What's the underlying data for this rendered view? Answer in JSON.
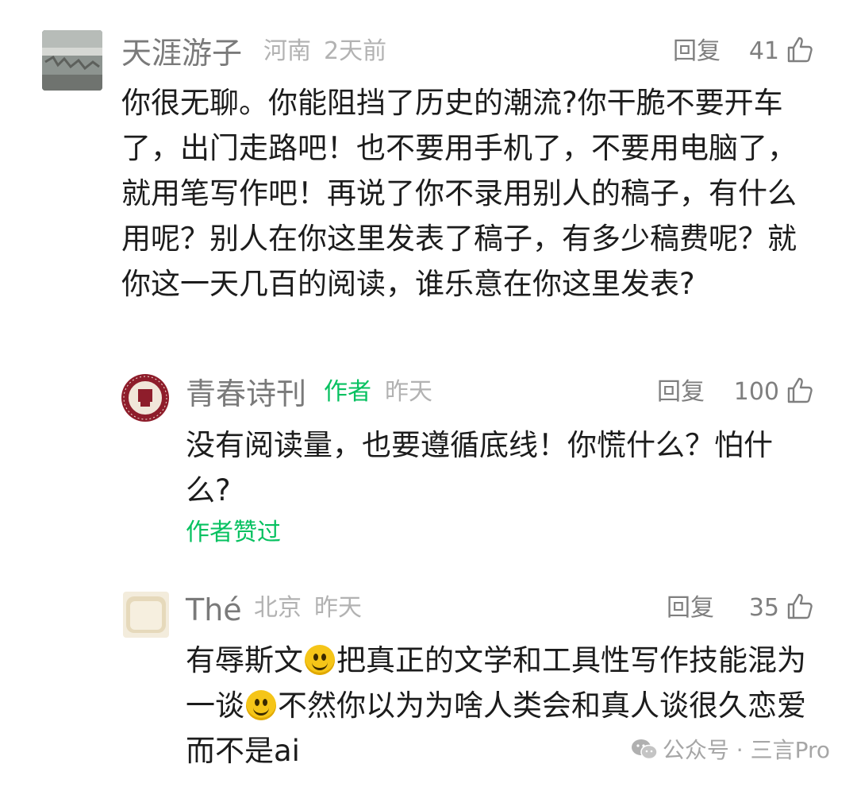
{
  "comments": [
    {
      "name": "天涯游子",
      "location": "河南",
      "time": "2天前",
      "reply_label": "回复",
      "likes": "41",
      "text": "你很无聊。你能阻挡了历史的潮流?你干脆不要开车了，出门走路吧！也不要用手机了，不要用电脑了，就用笔写作吧！再说了你不录用别人的稿子，有什么用呢？别人在你这里发表了稿子，有多少稿费呢？就你这一天几百的阅读，谁乐意在你这里发表?"
    },
    {
      "name": "青春诗刊",
      "author_tag": "作者",
      "time": "昨天",
      "reply_label": "回复",
      "likes": "100",
      "text": "没有阅读量，也要遵循底线！你慌什么？怕什么?",
      "liked_by_author": "作者赞过"
    },
    {
      "name": "Thé",
      "location": "北京",
      "time": "昨天",
      "reply_label": "回复",
      "likes": "35",
      "text_parts": [
        "有辱斯文",
        "把真正的文学和工具性写作技能混为一谈",
        "不然你以为为啥人类会和真人谈很久恋爱而不是ai"
      ],
      "emoji": "smile-emoji"
    }
  ],
  "watermark": "公众号 · 三言Pro",
  "colors": {
    "accent_green": "#07c160",
    "meta_gray": "#b2b2b2",
    "name_gray": "#7a7a7a"
  }
}
